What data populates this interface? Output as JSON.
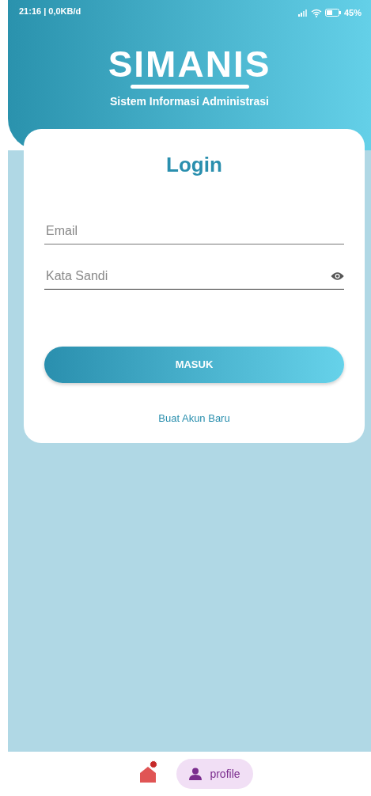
{
  "status_bar": {
    "time_and_data": "21:16 | 0,0KB/d",
    "battery": "45%"
  },
  "header": {
    "logo": "SIMANIS",
    "subtitle": "Sistem Informasi Administrasi"
  },
  "login_card": {
    "title": "Login",
    "fields": [
      {
        "kind": "text",
        "placeholder": "Email"
      },
      {
        "kind": "password",
        "placeholder": "Kata Sandi"
      }
    ],
    "submit": "MASUK",
    "link": "Buat Akun Baru"
  },
  "bottom_nav": [
    {
      "kind": "home",
      "selected": false,
      "badge": true
    },
    {
      "kind": "profile",
      "label": "profile",
      "selected": true,
      "badge": false
    }
  ]
}
